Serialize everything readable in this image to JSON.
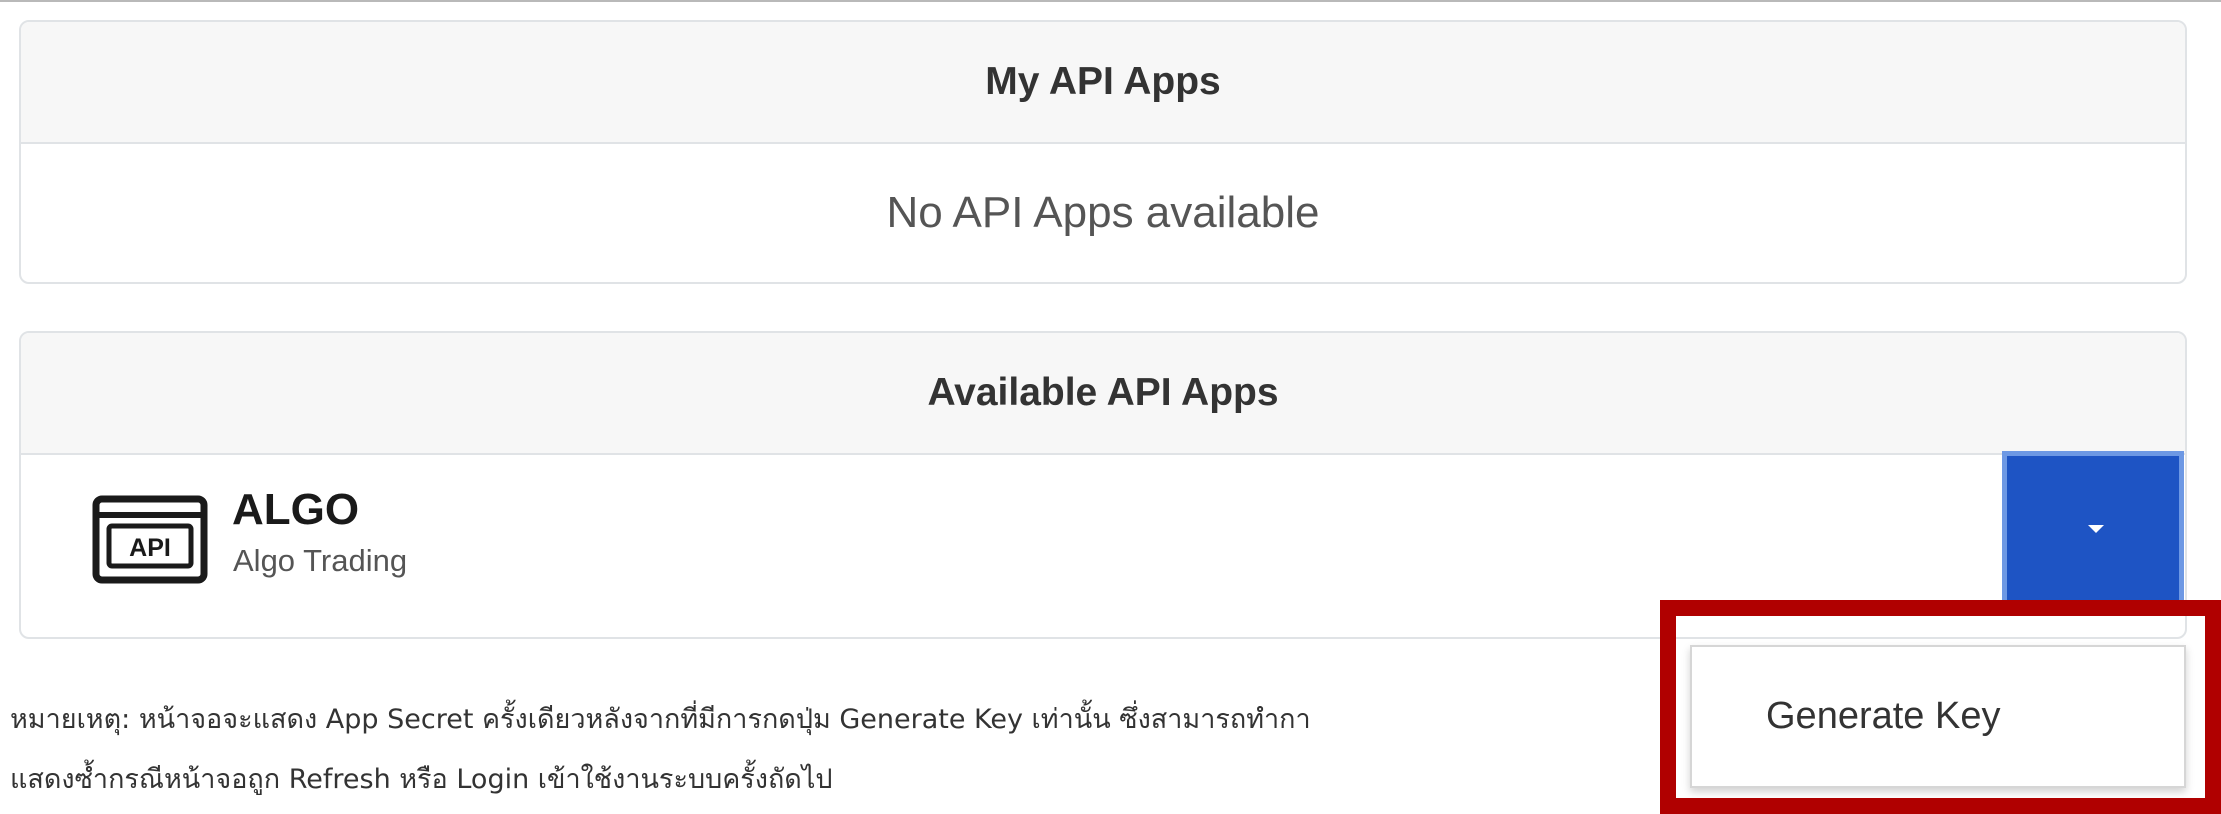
{
  "my_api_apps": {
    "title": "My API Apps",
    "empty_message": "No API Apps available"
  },
  "available_api_apps": {
    "title": "Available API Apps",
    "apps": [
      {
        "icon": "api-window-icon",
        "icon_text": "API",
        "name": "ALGO",
        "description": "Algo Trading"
      }
    ]
  },
  "dropdown": {
    "toggle_icon": "caret-down-icon",
    "items": [
      "Generate Key"
    ]
  },
  "note": {
    "line1": "หมายเหตุ: หน้าจอจะแสดง App Secret ครั้งเดียวหลังจากที่มีการกดปุ่ม Generate Key เท่านั้น ซึ่งสามารถทำกา",
    "line2": "แสดงซ้ำกรณีหน้าจอถูก Refresh หรือ Login เข้าใช้งานระบบครั้งถัดไป"
  },
  "colors": {
    "primary_button": "#1e54c4",
    "highlight": "#b00000",
    "card_header_bg": "#f7f7f7",
    "card_border": "#e0e3e6"
  }
}
